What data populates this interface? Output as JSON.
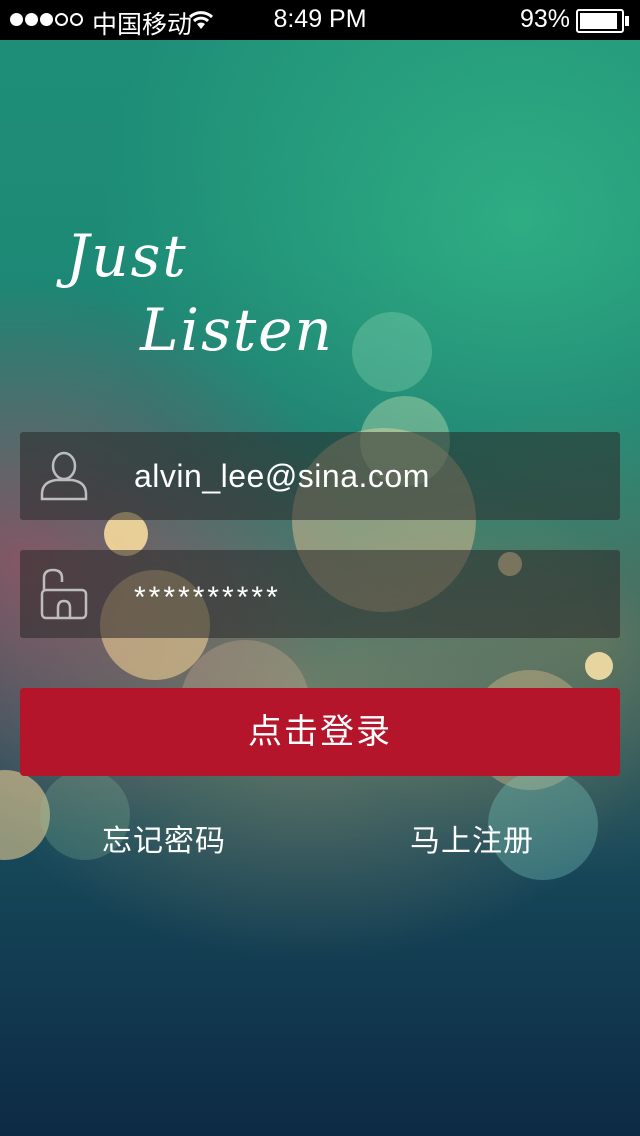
{
  "status_bar": {
    "carrier": "中国移动",
    "time": "8:49 PM",
    "battery": "93%",
    "signal_bars_filled": 3,
    "signal_bars_total": 5,
    "battery_level": 0.93
  },
  "logo": {
    "line1": "Just",
    "line2": "Listen"
  },
  "login_form": {
    "username_value": "alvin_lee@sina.com",
    "password_value": "**********",
    "username_icon": "user-icon",
    "password_icon": "unlock-icon",
    "login_label": "点击登录"
  },
  "links": {
    "forgot_password": "忘记密码",
    "register": "马上注册"
  },
  "colors": {
    "login_button": "#b5152a",
    "status_bar": "#000000"
  }
}
